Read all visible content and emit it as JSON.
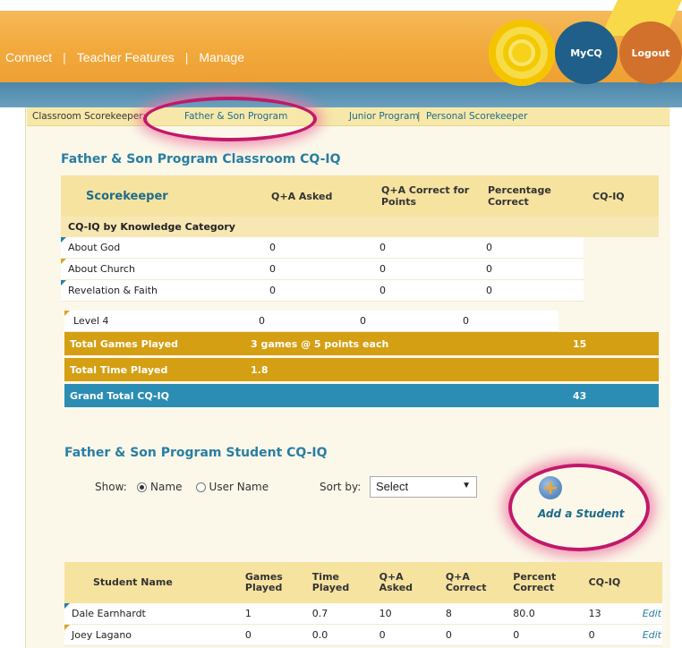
{
  "header": {
    "nav": [
      "Connect",
      "Teacher Features",
      "Manage"
    ],
    "myco_label": "MyCQ",
    "logout_label": "Logout"
  },
  "breadcrumb": {
    "label": "Classroom Scorekeeper:",
    "links": [
      "Father & Son Program",
      "Junior Program",
      "Personal Scorekeeper"
    ],
    "separator": "|"
  },
  "classroom": {
    "title": "Father & Son Program Classroom CQ-IQ",
    "columns": [
      "Scorekeeper",
      "Q+A Asked",
      "Q+A Correct for Points",
      "Percentage Correct",
      "CQ-IQ"
    ],
    "category_header": "CQ-IQ by Knowledge Category",
    "rows": [
      {
        "name": "About God",
        "asked": "0",
        "correct": "0",
        "pct": "0"
      },
      {
        "name": "About Church",
        "asked": "0",
        "correct": "0",
        "pct": "0"
      },
      {
        "name": "Revelation & Faith",
        "asked": "0",
        "correct": "0",
        "pct": "0"
      },
      {
        "name": "Level 4",
        "asked": "0",
        "correct": "0",
        "pct": "0"
      }
    ],
    "total_games": {
      "label": "Total Games Played",
      "detail": "3 games @ 5 points each",
      "value": "15"
    },
    "total_time": {
      "label": "Total Time Played",
      "detail": "1.8"
    },
    "grand_total": {
      "label": "Grand Total CQ-IQ",
      "value": "43"
    }
  },
  "students": {
    "title": "Father & Son Program Student CQ-IQ",
    "show_label": "Show:",
    "show_name": "Name",
    "show_username": "User Name",
    "sort_label": "Sort by:",
    "sort_value": "Select",
    "add_label": "Add a Student",
    "columns": [
      "Student Name",
      "Games Played",
      "Time Played",
      "Q+A Asked",
      "Q+A Correct",
      "Percent Correct",
      "CQ-IQ",
      ""
    ],
    "rows": [
      {
        "name": "Dale Earnhardt",
        "games": "1",
        "time": "0.7",
        "asked": "10",
        "correct": "8",
        "pct": "80.0",
        "cqiq": "13",
        "edit": "Edit"
      },
      {
        "name": "Joey Lagano",
        "games": "0",
        "time": "0.0",
        "asked": "0",
        "correct": "0",
        "pct": "0",
        "cqiq": "0",
        "edit": "Edit"
      }
    ]
  },
  "colors": {
    "orange_band": "#f2a93c",
    "accent_blue": "#2a7ea3",
    "gold_bar": "#d59f14",
    "highlight": "#c2186b"
  }
}
